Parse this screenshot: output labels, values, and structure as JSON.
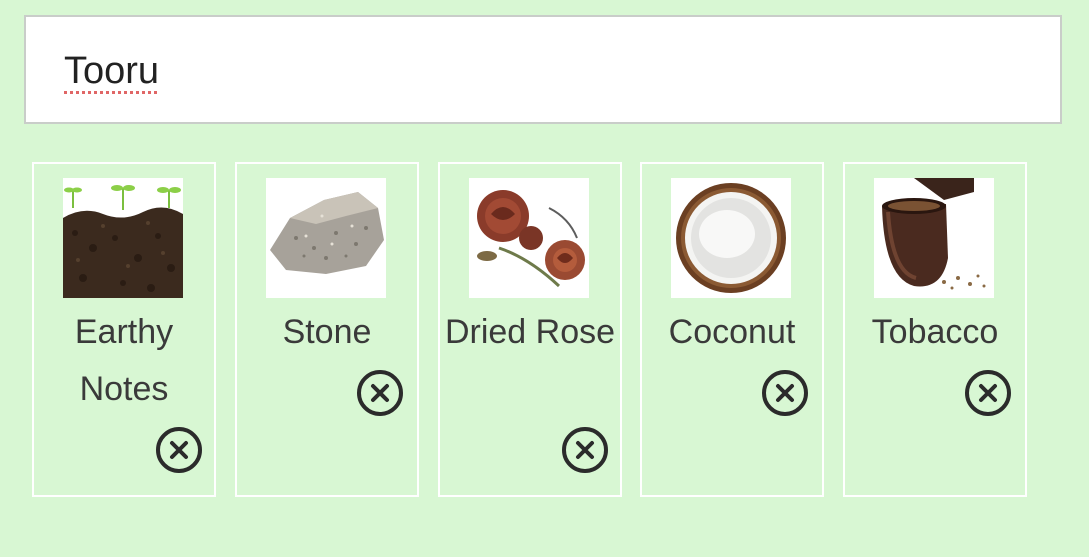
{
  "search": {
    "value": "Tooru"
  },
  "notes": [
    {
      "label": "Earthy Notes",
      "image": "soil-seedlings-image",
      "remove_icon": "close-circle-icon"
    },
    {
      "label": "Stone",
      "image": "stone-image",
      "remove_icon": "close-circle-icon"
    },
    {
      "label": "Dried Rose",
      "image": "dried-rose-image",
      "remove_icon": "close-circle-icon"
    },
    {
      "label": "Coconut",
      "image": "coconut-image",
      "remove_icon": "close-circle-icon"
    },
    {
      "label": "Tobacco",
      "image": "tobacco-pipe-image",
      "remove_icon": "close-circle-icon"
    }
  ],
  "colors": {
    "background": "#d8f7d3",
    "card_border": "#ffffff",
    "input_border": "#c9cdc9",
    "text": "#3a3a3a",
    "spellcheck_underline": "#e06666"
  }
}
